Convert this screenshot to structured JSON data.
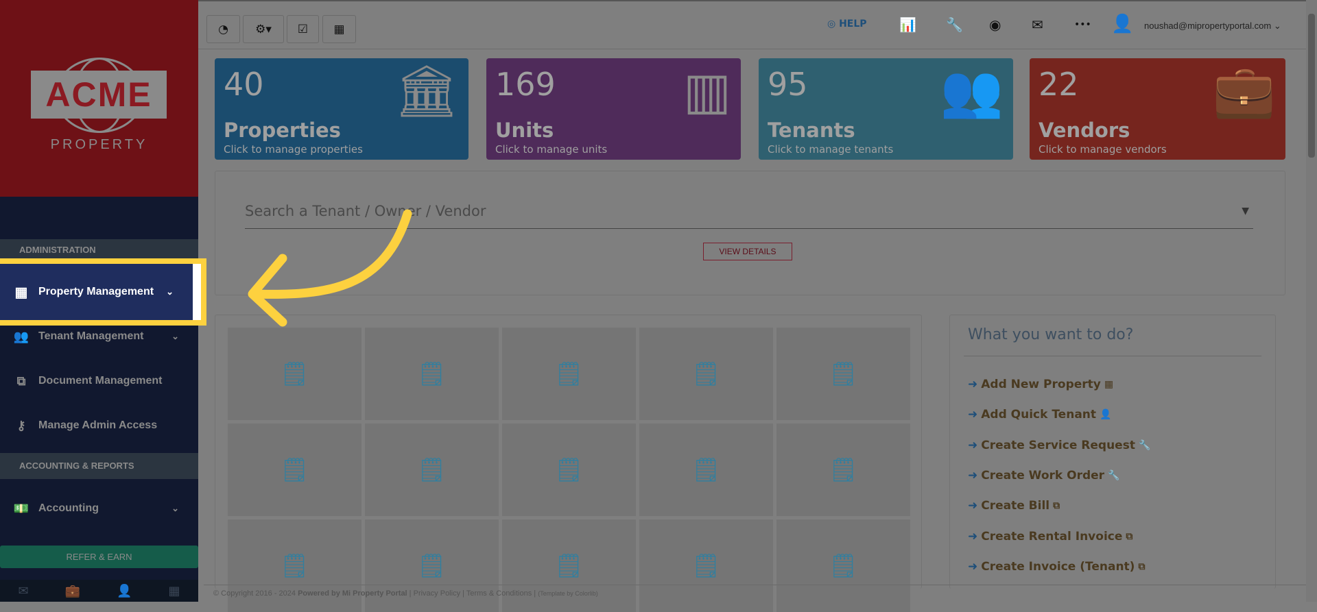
{
  "logo": {
    "name": "ACME",
    "sub": "PROPERTY"
  },
  "sidebar": {
    "section_admin": "ADMINISTRATION",
    "items": [
      {
        "label": "Property Management",
        "icon": "building-icon"
      },
      {
        "label": "Tenant Management",
        "icon": "users-icon"
      },
      {
        "label": "Document Management",
        "icon": "copy-icon"
      },
      {
        "label": "Manage Admin Access",
        "icon": "key-icon"
      }
    ],
    "section_accounting": "ACCOUNTING & REPORTS",
    "accounting": "Accounting",
    "refer": "REFER & EARN"
  },
  "topbar": {
    "help": "HELP",
    "user": "noushad@mipropertyportal.com"
  },
  "cards": [
    {
      "num": "40",
      "label": "Properties",
      "sub": "Click to manage properties",
      "color": "#1b4c6e"
    },
    {
      "num": "169",
      "label": "Units",
      "sub": "Click to manage units",
      "color": "#4f2b5a"
    },
    {
      "num": "95",
      "label": "Tenants",
      "sub": "Click to manage tenants",
      "color": "#2f6070"
    },
    {
      "num": "22",
      "label": "Vendors",
      "sub": "Click to manage vendors",
      "color": "#76251e"
    }
  ],
  "search": {
    "placeholder": "Search a Tenant / Owner / Vendor",
    "view_details": "VIEW DETAILS"
  },
  "actions": {
    "title": "What you want to do?",
    "items": [
      "Add New Property",
      "Add Quick Tenant",
      "Create Service Request",
      "Create Work Order",
      "Create Bill",
      "Create Rental Invoice",
      "Create Invoice (Tenant)"
    ]
  },
  "footer": {
    "copyright": "© Copyright 2016 - 2024",
    "powered": "Powered by Mi Property Portal",
    "privacy": "Privacy Policy",
    "terms": "Terms & Conditions",
    "template": "(Template by Colorlib)"
  },
  "highlight_color": "#fdd13f"
}
